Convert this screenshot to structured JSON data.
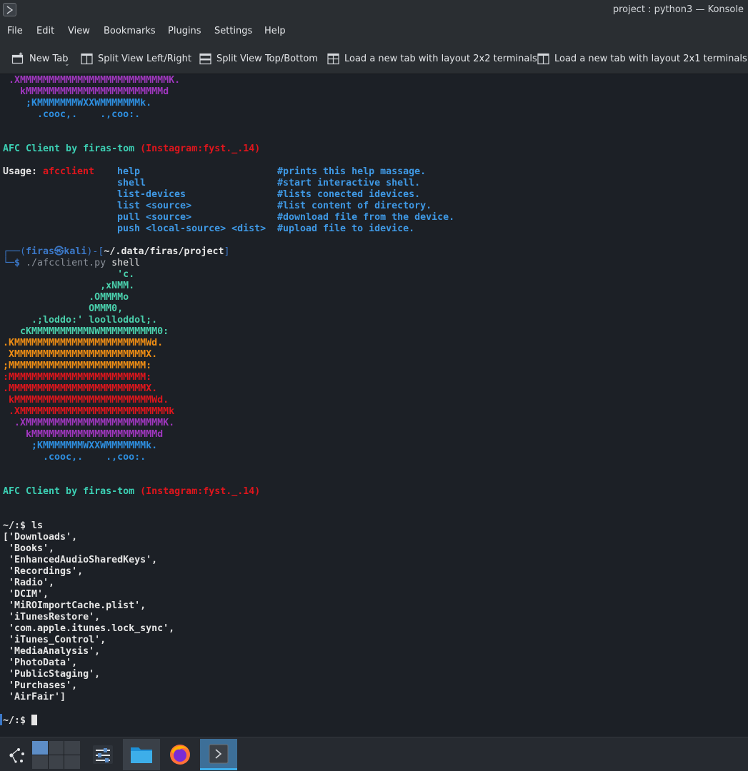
{
  "window": {
    "title": "project : python3 — Konsole",
    "app_icon": "terminal-app-icon"
  },
  "menu": [
    "File",
    "Edit",
    "View",
    "Bookmarks",
    "Plugins",
    "Settings",
    "Help"
  ],
  "toolbar": {
    "new_tab": "New Tab",
    "split_lr": "Split View Left/Right",
    "split_tb": "Split View Top/Bottom",
    "layout_2x2": "Load a new tab with layout 2x2 terminals",
    "layout_2x1": "Load a new tab with layout 2x1 terminals"
  },
  "terminal": {
    "top_art": {
      "l1": " .XMMMMMMMMMMMMMMMMMMMMMMMMMMK.",
      "l2": "   kMMMMMMMMMMMMMMMMMMMMMMMMd",
      "l3": "    ;KMMMMMMMWXXWMMMMMMMk.",
      "l4": "      .cooc,.    .,coo:."
    },
    "banner": {
      "name": "AFC Client by firas-tom",
      "insta": "(Instagram:fyst._.14)"
    },
    "usage": {
      "label": "Usage:",
      "prog": "afcclient",
      "rows": [
        {
          "cmd": "help",
          "desc": "#prints this help massage."
        },
        {
          "cmd": "shell",
          "desc": "#start interactive shell."
        },
        {
          "cmd": "list-devices",
          "desc": "#lists conected idevices."
        },
        {
          "cmd": "list <source>",
          "desc": "#list content of directory."
        },
        {
          "cmd": "pull <source>",
          "desc": "#download file from the device."
        },
        {
          "cmd": "push <local-source> <dist>",
          "desc": "#upload file to idevice."
        }
      ]
    },
    "prompt": {
      "corner_top": "┌──(",
      "user": "firas㉿kali",
      "mid": ")-[",
      "path": "~/.data/firas/project",
      "end": "]",
      "corner_bottom": "└─",
      "dollar": "$",
      "cmd": "./afcclient.py",
      "arg": "shell"
    },
    "apple_art": {
      "a1": "                    'c.",
      "a2": "                 ,xNMM.",
      "a3": "               .OMMMMo",
      "a4": "               OMMM0,",
      "a5": "     .;loddo:' loolloddol;.",
      "a6": "   cKMMMMMMMMMMNWMMMMMMMMMM0:",
      "a7": ".KMMMMMMMMMMMMMMMMMMMMMMMWd.",
      "a8": " XMMMMMMMMMMMMMMMMMMMMMMMX.",
      "a9": ";MMMMMMMMMMMMMMMMMMMMMMMM:",
      "a10": ":MMMMMMMMMMMMMMMMMMMMMMMM:",
      "a11": ".MMMMMMMMMMMMMMMMMMMMMMMMX.",
      "a12": " kMMMMMMMMMMMMMMMMMMMMMMMMWd.",
      "a13": " .XMMMMMMMMMMMMMMMMMMMMMMMMMMk",
      "a14": "  .XMMMMMMMMMMMMMMMMMMMMMMMMK.",
      "a15": "    kMMMMMMMMMMMMMMMMMMMMMMd",
      "a16": "     ;KMMMMMMMWXXWMMMMMMMk.",
      "a17": "       .cooc,.    .,coo:."
    },
    "shell_prompt": "~/:$",
    "ls_cmd": "ls",
    "ls_output": [
      "['Downloads',",
      " 'Books',",
      " 'EnhancedAudioSharedKeys',",
      " 'Recordings',",
      " 'Radio',",
      " 'DCIM',",
      " 'MiROImportCache.plist',",
      " 'iTunesRestore',",
      " 'com.apple.itunes.lock_sync',",
      " 'iTunes_Control',",
      " 'MediaAnalysis',",
      " 'PhotoData',",
      " 'PublicStaging',",
      " 'Purchases',",
      " 'AirFair']"
    ]
  },
  "taskbar": {
    "icons": [
      "app-launcher-icon",
      "virtual-desktop-pager",
      "system-settings-icon",
      "file-manager-icon",
      "firefox-icon",
      "konsole-icon"
    ]
  }
}
